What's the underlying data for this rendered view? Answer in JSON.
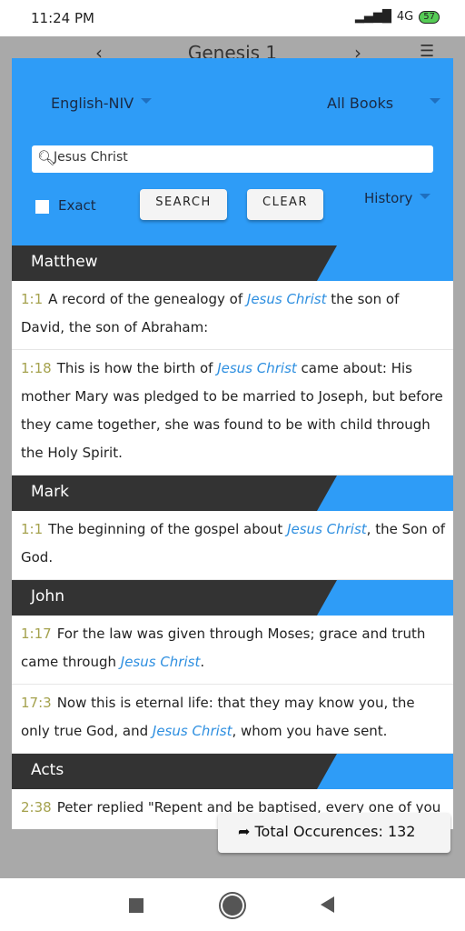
{
  "status": {
    "time": "11:24 PM",
    "network": "4G",
    "battery": "57"
  },
  "app": {
    "title": "Genesis 1",
    "prev": "‹",
    "next": "›"
  },
  "search": {
    "version": "English-NIV",
    "books": "All Books",
    "query": "Jesus Christ",
    "exact_label": "Exact",
    "exact_checked": false,
    "search_label": "SEARCH",
    "clear_label": "CLEAR",
    "history_label": "History"
  },
  "results": [
    {
      "book": "Matthew",
      "verses": [
        {
          "ref": "1:1",
          "pre": "A record of the genealogy of ",
          "hl": "Jesus Christ",
          "post": " the son of David, the son of Abraham:"
        },
        {
          "ref": "1:18",
          "pre": "This is how the birth of ",
          "hl": "Jesus Christ",
          "post": " came about: His mother Mary was pledged to be married to Joseph, but before they came together, she was found to be with child through the Holy Spirit."
        }
      ]
    },
    {
      "book": "Mark",
      "verses": [
        {
          "ref": "1:1",
          "pre": "The beginning of the gospel about ",
          "hl": "Jesus Christ",
          "post": ", the Son of God."
        }
      ]
    },
    {
      "book": "John",
      "verses": [
        {
          "ref": "1:17",
          "pre": "For the law was given through Moses; grace and truth came through ",
          "hl": "Jesus Christ",
          "post": "."
        },
        {
          "ref": "17:3",
          "pre": "Now this is eternal life: that they may know you, the only true God, and ",
          "hl": "Jesus Christ",
          "post": ", whom you have sent."
        }
      ]
    },
    {
      "book": "Acts",
      "verses": [
        {
          "ref": "2:38",
          "pre": "Peter replied \"Repent and be baptised, every one of you",
          "hl": "",
          "post": ""
        }
      ]
    }
  ],
  "total": {
    "label": "Total Occurences: 132"
  },
  "colors": {
    "accent": "#2e9cf7",
    "header": "#333333",
    "ref": "#a5a24e",
    "highlight": "#2e8fe0"
  }
}
